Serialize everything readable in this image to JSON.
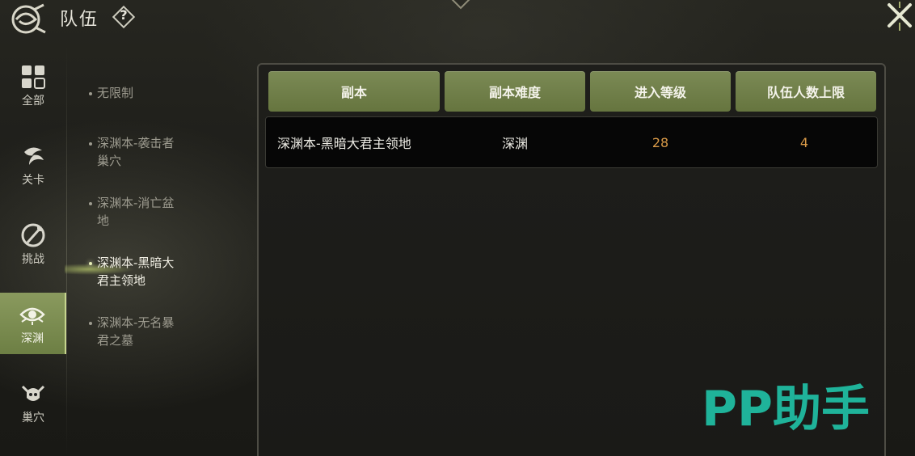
{
  "header": {
    "title": "队伍",
    "help_symbol": "?"
  },
  "rail": {
    "items": [
      {
        "label": "全部",
        "icon": "grid-icon"
      },
      {
        "label": "关卡",
        "icon": "swirl-icon"
      },
      {
        "label": "挑战",
        "icon": "sword-icon"
      },
      {
        "label": "深渊",
        "icon": "eye-icon",
        "active": true
      },
      {
        "label": "巢穴",
        "icon": "demon-skull-icon"
      }
    ]
  },
  "sublist": {
    "items": [
      {
        "line1": "无限制",
        "line2": ""
      },
      {
        "line1": "深渊本-袭击者",
        "line2": "巢穴"
      },
      {
        "line1": "深渊本-消亡盆",
        "line2": "地"
      },
      {
        "line1": "深渊本-黑暗大",
        "line2": "君主领地",
        "active": true
      },
      {
        "line1": "深渊本-无名暴",
        "line2": "君之墓"
      }
    ]
  },
  "table": {
    "columns": [
      "副本",
      "副本难度",
      "进入等级",
      "队伍人数上限"
    ],
    "rows": [
      {
        "dungeon": "深渊本-黑暗大君主领地",
        "difficulty": "深渊",
        "level": "28",
        "max_members": "4"
      }
    ]
  },
  "watermark": {
    "text": "PP助手"
  },
  "colors": {
    "accent_green": "#7b8a55",
    "number_orange": "#d99a48",
    "watermark_teal": "#1fb39a"
  }
}
